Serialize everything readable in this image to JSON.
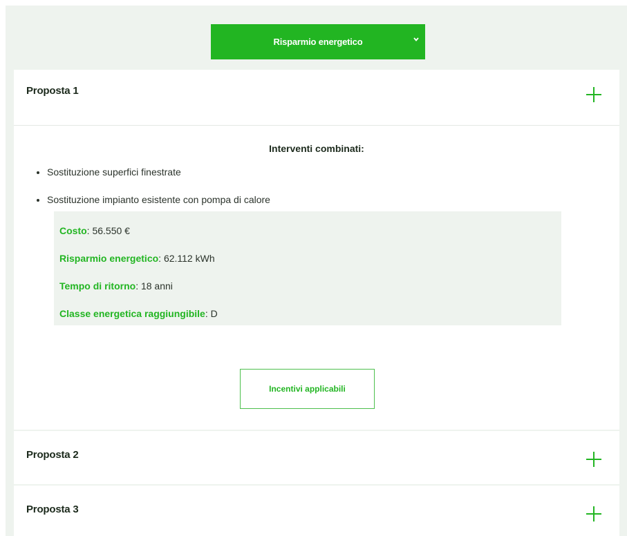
{
  "selector": {
    "label": "Risparmio energetico",
    "icon": "chevron-down-icon"
  },
  "proposals": [
    {
      "title": "Proposta 1",
      "expanded": true,
      "section_title": "Interventi combinati:",
      "bullets": [
        "Sostituzione superfici finestrate",
        "Sostituzione impianto esistente con pompa di calore"
      ],
      "details": [
        {
          "label": "Costo",
          "separator": ": ",
          "value": "56.550 €"
        },
        {
          "label": "Risparmio energetico",
          "separator": ": ",
          "value": "62.112 kWh"
        },
        {
          "label": "Tempo di ritorno",
          "separator": ": ",
          "value": "18 anni"
        },
        {
          "label": "Classe energetica raggiungibile",
          "separator": ": ",
          "value": "D"
        }
      ],
      "button_label": "Incentivi applicabili"
    },
    {
      "title": "Proposta 2",
      "expanded": false
    },
    {
      "title": "Proposta 3",
      "expanded": false
    }
  ],
  "colors": {
    "accent": "#22b522",
    "page_background": "#eef3ee",
    "card_background": "#ffffff",
    "title_text": "#1c2a1c"
  }
}
